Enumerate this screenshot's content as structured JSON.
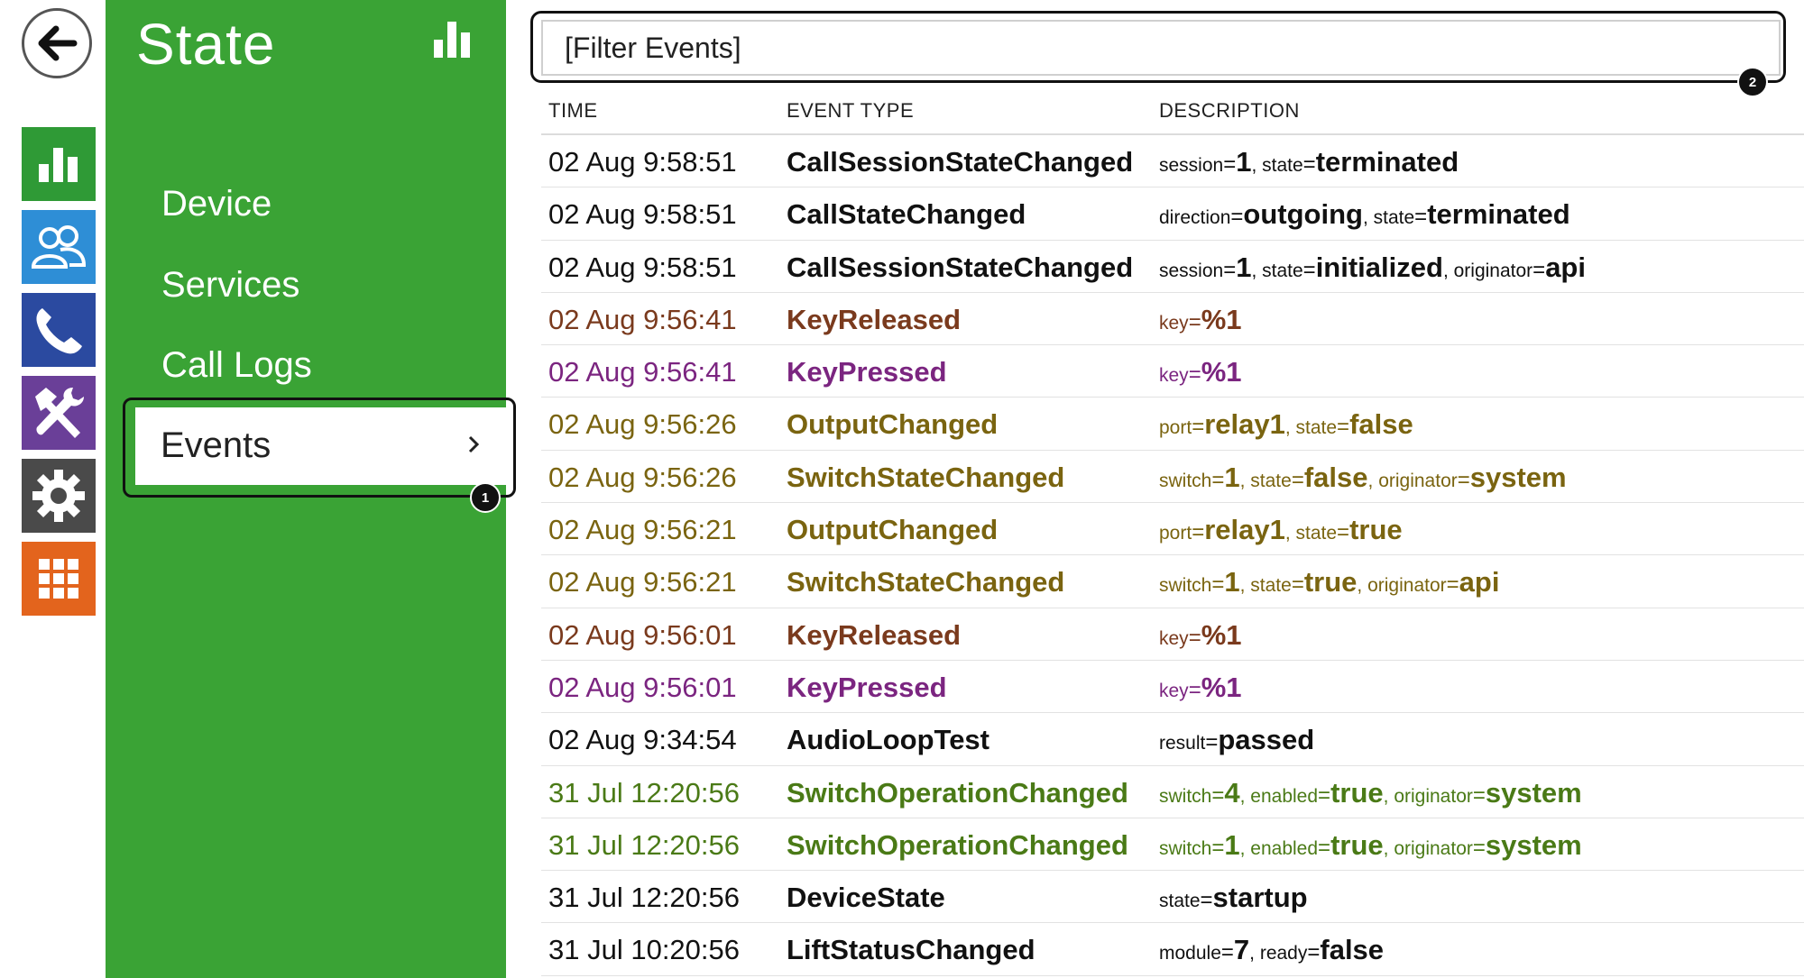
{
  "menu": {
    "title": "State",
    "title_icon": "bar-chart-icon",
    "items": [
      {
        "label": "Device"
      },
      {
        "label": "Services"
      },
      {
        "label": "Call Logs"
      },
      {
        "label": "Events"
      }
    ],
    "active_index": 3
  },
  "rail": {
    "back_icon": "back-arrow-icon",
    "tiles": [
      {
        "icon": "status-chart-icon",
        "color": "#2f9a36"
      },
      {
        "icon": "users-icon",
        "color": "#2e8ed6"
      },
      {
        "icon": "phone-icon",
        "color": "#2b4aa0"
      },
      {
        "icon": "hardware-tools-icon",
        "color": "#6a3f98"
      },
      {
        "icon": "gear-icon",
        "color": "#4a4a4a"
      },
      {
        "icon": "grid-icon",
        "color": "#e3641d"
      }
    ]
  },
  "badges": {
    "events": "1",
    "filter": "2"
  },
  "filter": {
    "placeholder": "[Filter Events]"
  },
  "table": {
    "headers": {
      "time": "TIME",
      "type": "EVENT TYPE",
      "desc": "DESCRIPTION"
    },
    "rows": [
      {
        "time": "02 Aug 9:58:51",
        "type": "CallSessionStateChanged",
        "color": "#111111",
        "params": [
          [
            "session",
            "1"
          ],
          [
            "state",
            "terminated"
          ]
        ]
      },
      {
        "time": "02 Aug 9:58:51",
        "type": "CallStateChanged",
        "color": "#111111",
        "params": [
          [
            "direction",
            "outgoing"
          ],
          [
            "state",
            "terminated"
          ]
        ]
      },
      {
        "time": "02 Aug 9:58:51",
        "type": "CallSessionStateChanged",
        "color": "#111111",
        "params": [
          [
            "session",
            "1"
          ],
          [
            "state",
            "initialized"
          ],
          [
            "originator",
            "api"
          ]
        ]
      },
      {
        "time": "02 Aug 9:56:41",
        "type": "KeyReleased",
        "color": "#7a3a1d",
        "params": [
          [
            "key",
            "%1"
          ]
        ]
      },
      {
        "time": "02 Aug 9:56:41",
        "type": "KeyPressed",
        "color": "#7b2580",
        "params": [
          [
            "key",
            "%1"
          ]
        ]
      },
      {
        "time": "02 Aug 9:56:26",
        "type": "OutputChanged",
        "color": "#7a6410",
        "params": [
          [
            "port",
            "relay1"
          ],
          [
            "state",
            "false"
          ]
        ]
      },
      {
        "time": "02 Aug 9:56:26",
        "type": "SwitchStateChanged",
        "color": "#7a6410",
        "params": [
          [
            "switch",
            "1"
          ],
          [
            "state",
            "false"
          ],
          [
            "originator",
            "system"
          ]
        ]
      },
      {
        "time": "02 Aug 9:56:21",
        "type": "OutputChanged",
        "color": "#7a6410",
        "params": [
          [
            "port",
            "relay1"
          ],
          [
            "state",
            "true"
          ]
        ]
      },
      {
        "time": "02 Aug 9:56:21",
        "type": "SwitchStateChanged",
        "color": "#7a6410",
        "params": [
          [
            "switch",
            "1"
          ],
          [
            "state",
            "true"
          ],
          [
            "originator",
            "api"
          ]
        ]
      },
      {
        "time": "02 Aug 9:56:01",
        "type": "KeyReleased",
        "color": "#7a3a1d",
        "params": [
          [
            "key",
            "%1"
          ]
        ]
      },
      {
        "time": "02 Aug 9:56:01",
        "type": "KeyPressed",
        "color": "#7b2580",
        "params": [
          [
            "key",
            "%1"
          ]
        ]
      },
      {
        "time": "02 Aug 9:34:54",
        "type": "AudioLoopTest",
        "color": "#111111",
        "params": [
          [
            "result",
            "passed"
          ]
        ]
      },
      {
        "time": "31 Jul 12:20:56",
        "type": "SwitchOperationChanged",
        "color": "#4a7a16",
        "params": [
          [
            "switch",
            "4"
          ],
          [
            "enabled",
            "true"
          ],
          [
            "originator",
            "system"
          ]
        ]
      },
      {
        "time": "31 Jul 12:20:56",
        "type": "SwitchOperationChanged",
        "color": "#4a7a16",
        "params": [
          [
            "switch",
            "1"
          ],
          [
            "enabled",
            "true"
          ],
          [
            "originator",
            "system"
          ]
        ]
      },
      {
        "time": "31 Jul 12:20:56",
        "type": "DeviceState",
        "color": "#111111",
        "params": [
          [
            "state",
            "startup"
          ]
        ]
      },
      {
        "time": "31 Jul 10:20:56",
        "type": "LiftStatusChanged",
        "color": "#111111",
        "params": [
          [
            "module",
            "7"
          ],
          [
            "ready",
            "false"
          ]
        ]
      }
    ]
  }
}
